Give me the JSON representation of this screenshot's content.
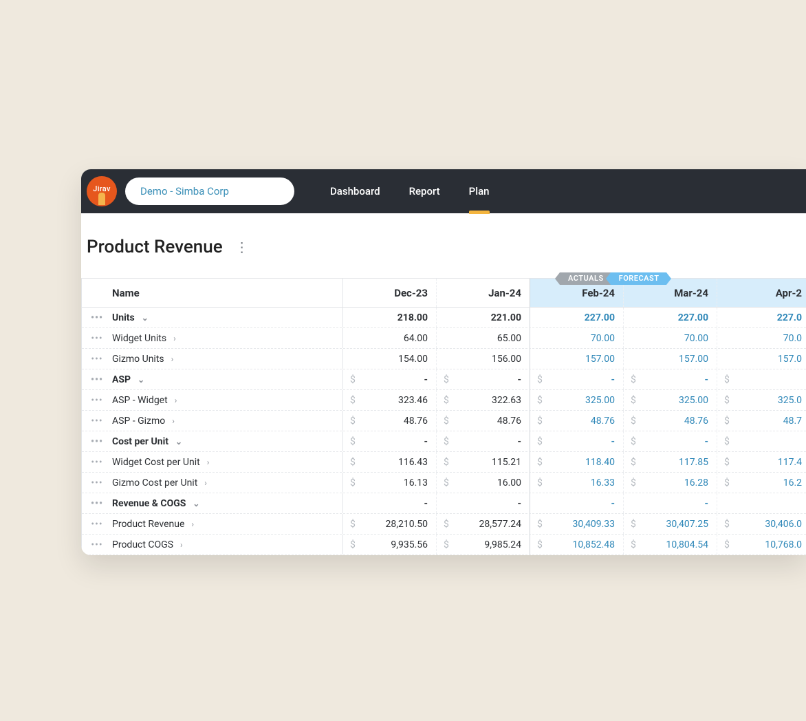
{
  "brand": "Jirav",
  "org": "Demo - Simba Corp",
  "nav": {
    "dashboard": "Dashboard",
    "report": "Report",
    "plan": "Plan"
  },
  "page": {
    "title": "Product Revenue"
  },
  "labels": {
    "actuals": "ACTUALS",
    "forecast": "FORECAST"
  },
  "columns": {
    "name": "Name",
    "c0": "Dec-23",
    "c1": "Jan-24",
    "c2": "Feb-24",
    "c3": "Mar-24",
    "c4": "Apr-2"
  },
  "rows": [
    {
      "type": "section",
      "name": "Units",
      "caret": "down",
      "cur": false,
      "v": [
        "218.00",
        "221.00",
        "227.00",
        "227.00",
        "227.0"
      ]
    },
    {
      "type": "child",
      "name": "Widget Units",
      "caret": "right",
      "cur": false,
      "v": [
        "64.00",
        "65.00",
        "70.00",
        "70.00",
        "70.0"
      ]
    },
    {
      "type": "child",
      "name": "Gizmo Units",
      "caret": "right",
      "cur": false,
      "v": [
        "154.00",
        "156.00",
        "157.00",
        "157.00",
        "157.0"
      ]
    },
    {
      "type": "section",
      "name": "ASP",
      "caret": "down",
      "cur": true,
      "v": [
        "-",
        "-",
        "-",
        "-",
        ""
      ]
    },
    {
      "type": "child",
      "name": "ASP - Widget",
      "caret": "right",
      "cur": true,
      "v": [
        "323.46",
        "322.63",
        "325.00",
        "325.00",
        "325.0"
      ]
    },
    {
      "type": "child",
      "name": "ASP - Gizmo",
      "caret": "right",
      "cur": true,
      "v": [
        "48.76",
        "48.76",
        "48.76",
        "48.76",
        "48.7"
      ]
    },
    {
      "type": "section",
      "name": "Cost per Unit",
      "caret": "down",
      "cur": true,
      "v": [
        "-",
        "-",
        "-",
        "-",
        ""
      ]
    },
    {
      "type": "child",
      "name": "Widget Cost per Unit",
      "caret": "right",
      "cur": true,
      "v": [
        "116.43",
        "115.21",
        "118.40",
        "117.85",
        "117.4"
      ]
    },
    {
      "type": "child",
      "name": "Gizmo Cost per Unit",
      "caret": "right",
      "cur": true,
      "v": [
        "16.13",
        "16.00",
        "16.33",
        "16.28",
        "16.2"
      ]
    },
    {
      "type": "section",
      "name": "Revenue & COGS",
      "caret": "down",
      "cur": false,
      "v": [
        "-",
        "-",
        "-",
        "-",
        ""
      ]
    },
    {
      "type": "child",
      "name": "Product Revenue",
      "caret": "right",
      "cur": true,
      "v": [
        "28,210.50",
        "28,577.24",
        "30,409.33",
        "30,407.25",
        "30,406.0"
      ]
    },
    {
      "type": "child",
      "name": "Product COGS",
      "caret": "right",
      "cur": true,
      "v": [
        "9,935.56",
        "9,985.24",
        "10,852.48",
        "10,804.54",
        "10,768.0"
      ]
    }
  ]
}
